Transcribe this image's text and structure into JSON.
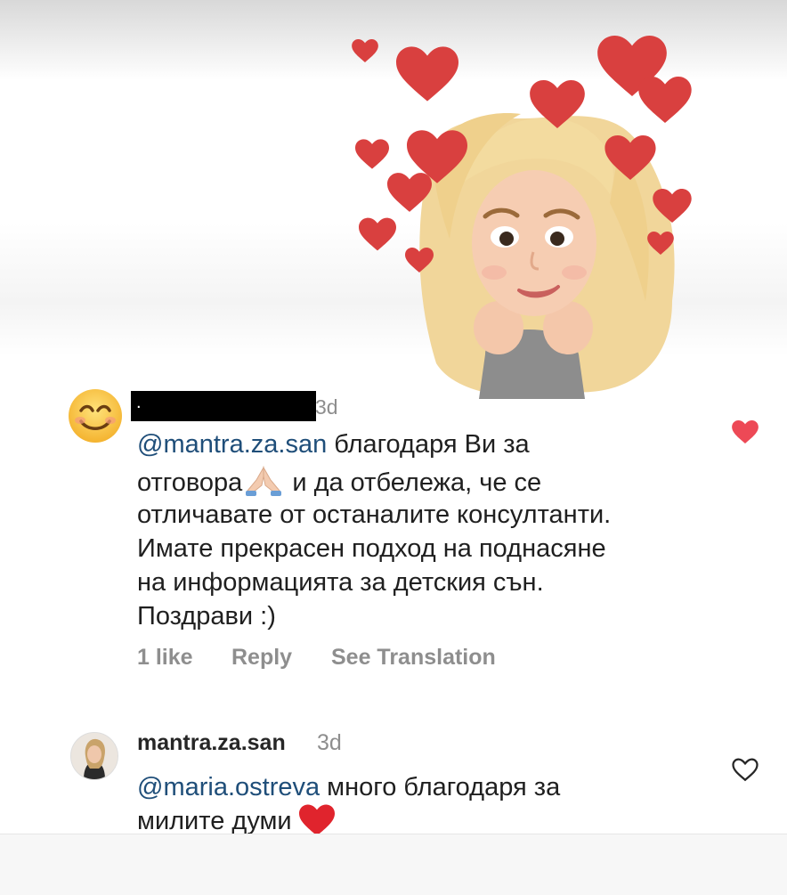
{
  "sticker": {
    "icon": "memoji-sticker-with-hearts"
  },
  "comment": {
    "avatar_icon": "smiling-face-emoji",
    "username_redacted": ".",
    "time": "3d",
    "mention": "@mantra.za.san",
    "line1_rest": " благодаря Ви за",
    "line2_a": "отговора",
    "line2_b": "и да отбележа, че се",
    "line3": "отличавате от останалите консултанти.",
    "line4": "Имате прекрасен подход на поднасяне",
    "line5": "на информацията за детския сън.",
    "line6": "Поздрави :)",
    "likes": "1 like",
    "reply_label": "Reply",
    "translate_label": "See Translation",
    "liked": true
  },
  "reply": {
    "username": "mantra.za.san",
    "time": "3d",
    "mention": "@maria.ostreva",
    "line1_rest": " много благодаря за",
    "line2": "милите думи",
    "liked": false
  },
  "colors": {
    "mention": "#1f4e79",
    "like_red": "#ed4956",
    "muted": "#8e8e8e"
  }
}
